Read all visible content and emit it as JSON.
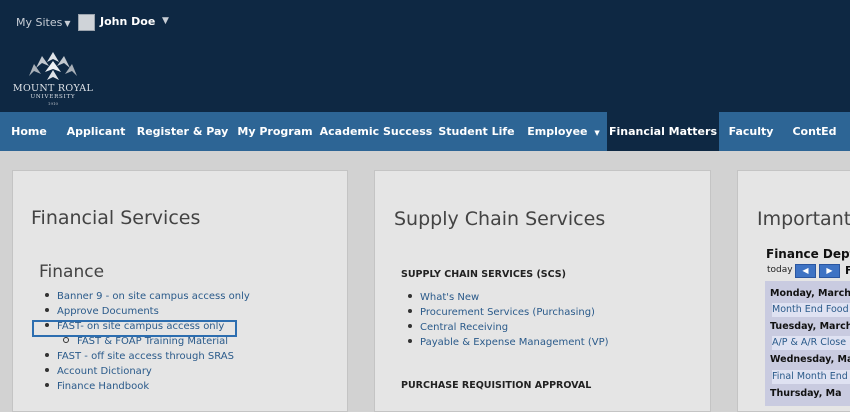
{
  "topbar": {
    "my_sites": "My Sites",
    "user_name": "John Doe",
    "logo": {
      "line1": "MOUNT ROYAL",
      "line2": "UNIVERSITY",
      "line3": "1910"
    }
  },
  "nav": [
    {
      "label": "Home"
    },
    {
      "label": "Applicant"
    },
    {
      "label": "Register & Pay"
    },
    {
      "label": "My Program"
    },
    {
      "label": "Academic Success"
    },
    {
      "label": "Student Life"
    },
    {
      "label": "Employee"
    },
    {
      "label": "Financial Matters"
    },
    {
      "label": "Faculty"
    },
    {
      "label": "ContEd"
    }
  ],
  "financial": {
    "title": "Financial Services",
    "subtitle": "Finance",
    "links": [
      "Banner 9 - on site campus access only",
      "Approve Documents",
      "FAST- on site campus access only",
      "FAST & FOAP Training Material",
      "FAST - off site access through SRAS",
      "Account Dictionary",
      "Finance Handbook"
    ]
  },
  "supply": {
    "title": "Supply Chain Services",
    "section1": "SUPPLY CHAIN SERVICES (SCS)",
    "links": [
      "What's New",
      "Procurement Services (Purchasing)",
      "Central Receiving",
      "Payable & Expense Management (VP)"
    ],
    "section2": "PURCHASE REQUISITION APPROVAL"
  },
  "important": {
    "title": "Important D",
    "calendar_title": "Finance Dept C",
    "today": "today",
    "prev": "◀",
    "next": "▶",
    "month_letter": "F",
    "rows": [
      {
        "kind": "day",
        "text": "Monday, March"
      },
      {
        "kind": "event",
        "text": "Month End Food"
      },
      {
        "kind": "day",
        "text": "Tuesday, March"
      },
      {
        "kind": "event",
        "text": "A/P & A/R Close"
      },
      {
        "kind": "day",
        "text": "Wednesday, Ma"
      },
      {
        "kind": "event",
        "text": "Final Month End"
      },
      {
        "kind": "day",
        "text": "Thursday, Ma"
      }
    ]
  }
}
